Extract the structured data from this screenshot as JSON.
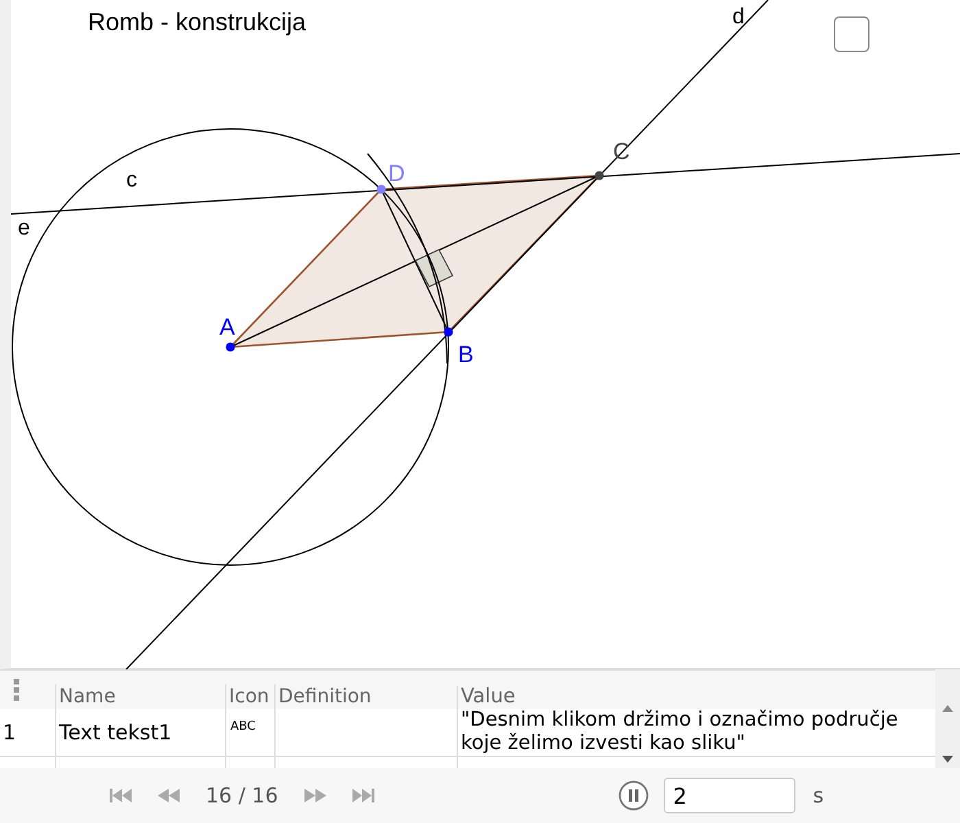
{
  "canvas": {
    "title": "Romb - konstrukcija",
    "checkbox": {
      "checked": false
    },
    "points": [
      {
        "label": "A",
        "color": "#0000ff"
      },
      {
        "label": "B",
        "color": "#0000ff"
      },
      {
        "label": "C",
        "color": "#444444"
      },
      {
        "label": "D",
        "color": "#7f7fff"
      }
    ],
    "objects": [
      {
        "label": "c"
      },
      {
        "label": "d"
      },
      {
        "label": "e"
      }
    ]
  },
  "algebra": {
    "columns": [
      "Name",
      "Icon",
      "Definition",
      "Value"
    ],
    "rows": [
      {
        "index": "1",
        "name": "Text tekst1",
        "icon": "ABC",
        "value": "\"Desnim klikom držimo i označimo područje koje želimo izvesti kao sliku\""
      }
    ]
  },
  "playback": {
    "step": "16 / 16",
    "playing": true,
    "speed": "2",
    "unit": "s"
  }
}
